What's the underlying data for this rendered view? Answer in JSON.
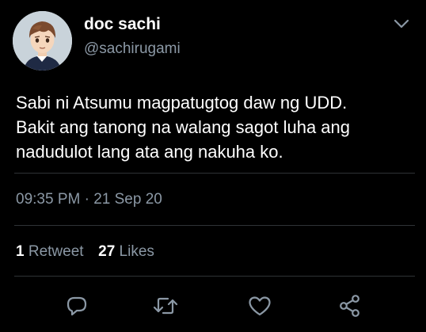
{
  "author": {
    "display_name": "doc sachi",
    "handle": "@sachirugami",
    "avatar_icon": "anime-character-avatar"
  },
  "tweet": {
    "lines": [
      "Sabi ni Atsumu magpatugtog daw ng UDD.",
      "Bakit ang tanong na walang sagot luha ang",
      "nadudulot lang ata ang nakuha ko."
    ],
    "timestamp": "09:35 PM · 21 Sep 20"
  },
  "stats": {
    "retweets_count": "1",
    "retweets_label": "Retweet",
    "likes_count": "27",
    "likes_label": "Likes"
  },
  "actions": [
    "reply-icon",
    "retweet-icon",
    "like-icon",
    "share-icon"
  ],
  "colors": {
    "background": "#000000",
    "text": "#ffffff",
    "secondary": "#8b98a5",
    "divider": "#2f3336"
  }
}
